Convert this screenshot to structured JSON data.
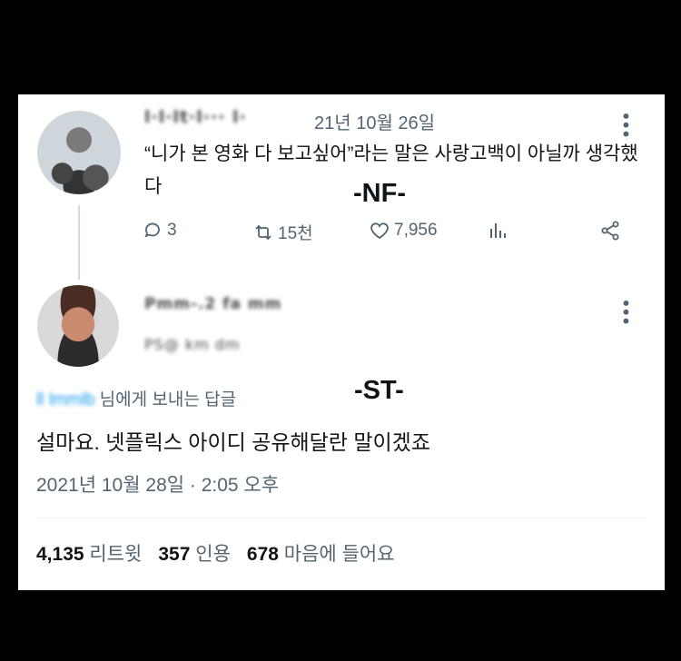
{
  "tweet": {
    "author_name_blurred": "l·l·lt·l··· l·",
    "date": "21년 10월 26일",
    "text": "“니가 본 영화 다 보고싶어”라는 말은 사랑고백이 아닐까 생각했다",
    "tag": "-NF-",
    "actions": {
      "reply_count": "3",
      "retweet_count": "15천",
      "like_count": "7,956"
    }
  },
  "reply": {
    "author_name_blurred": "Pmm-.2 fa mm",
    "handle_blurred": "PS@ km dm",
    "replying_to_blurred": "ll lmmlb",
    "replying_to_label": "님에게 보내는 답글",
    "tag": "-ST-",
    "text": "설마요. 넷플릭스 아이디 공유해달란 말이겠죠",
    "timestamp": "2021년 10월 28일 · 2:05 오후",
    "stats": {
      "retweets_value": "4,135",
      "retweets_label": "리트윗",
      "quotes_value": "357",
      "quotes_label": "인용",
      "likes_value": "678",
      "likes_label": "마음에 들어요"
    }
  },
  "colors": {
    "background": "#000000",
    "card": "#ffffff",
    "secondary_text": "#536471",
    "link": "#1d9bf0"
  }
}
